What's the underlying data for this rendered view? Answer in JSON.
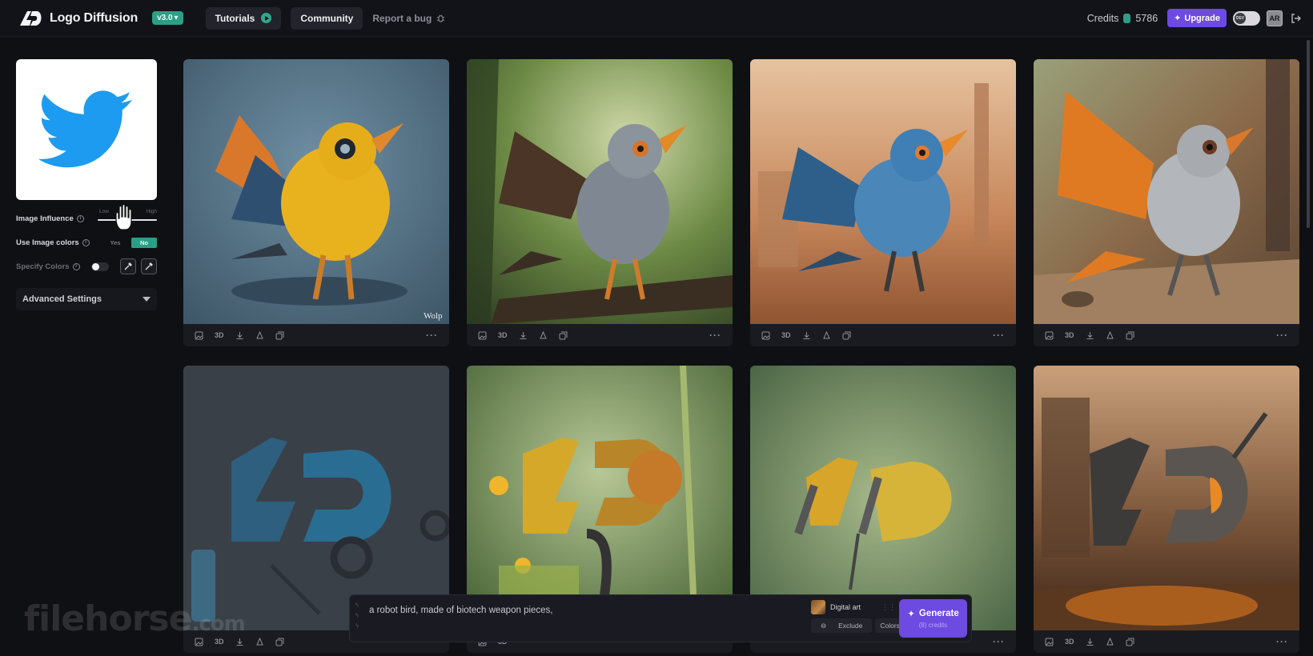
{
  "app": {
    "name": "Logo Diffusion",
    "version": "v3.0"
  },
  "nav": {
    "tutorials": "Tutorials",
    "community": "Community",
    "report_bug": "Report a bug"
  },
  "account": {
    "credits_label": "Credits",
    "credits_value": "5786",
    "upgrade": "Upgrade",
    "mode_toggle": "DEV",
    "avatar_initials": "AR"
  },
  "sidebar": {
    "image_influence": {
      "label": "Image Influence",
      "low": "Low",
      "high": "High",
      "level": 0.45
    },
    "use_image_colors": {
      "label": "Use Image colors",
      "yes": "Yes",
      "no": "No",
      "selected": "No"
    },
    "specify_colors": {
      "label": "Specify Colors",
      "enabled": false
    },
    "advanced_settings": "Advanced Settings"
  },
  "gallery": {
    "action_3d": "3D",
    "cards": [
      {
        "subject": "robot bird yellow",
        "watermark": "Wolp"
      },
      {
        "subject": "robot bird grey jungle",
        "watermark": ""
      },
      {
        "subject": "robot bird blue desert",
        "watermark": ""
      },
      {
        "subject": "robot bird orange factory",
        "watermark": ""
      },
      {
        "subject": "LD logo metallic blue",
        "watermark": ""
      },
      {
        "subject": "LD logo flowers",
        "watermark": ""
      },
      {
        "subject": "LD logo citrus",
        "watermark": ""
      },
      {
        "subject": "LD logo industrial sparks",
        "watermark": ""
      }
    ]
  },
  "prompt": {
    "text": "a robot bird, made of biotech weapon pieces,",
    "style": "Digital art",
    "exclude": "Exclude",
    "colors": "Colors",
    "generate": "Generate",
    "cost": "(8) credits"
  },
  "watermark": {
    "brand": "filehorse",
    "suffix": ".com"
  },
  "colors": {
    "accent_purple": "#6d4ae0",
    "accent_teal": "#2c9f86",
    "background": "#0f1014",
    "twitter_blue": "#1d9bf0"
  }
}
